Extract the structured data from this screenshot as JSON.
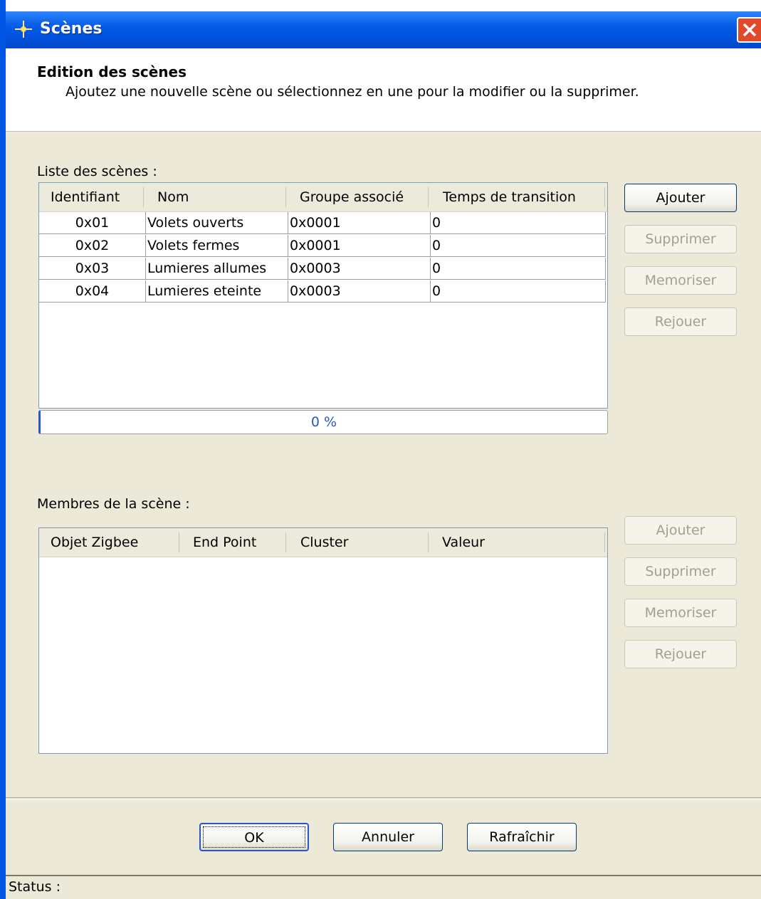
{
  "window": {
    "title": "Scènes"
  },
  "header": {
    "title": "Edition des scènes",
    "description": "Ajoutez une nouvelle scène ou sélectionnez en une pour la modifier ou la supprimer."
  },
  "scenes": {
    "label": "Liste des scènes :",
    "columns": [
      "Identifiant",
      "Nom",
      "Groupe associé",
      "Temps de transition"
    ],
    "rows": [
      [
        "0x01",
        "Volets ouverts",
        "0x0001",
        "0"
      ],
      [
        "0x02",
        "Volets fermes",
        "0x0001",
        "0"
      ],
      [
        "0x03",
        "Lumieres allumes",
        "0x0003",
        "0"
      ],
      [
        "0x04",
        "Lumieres eteinte",
        "0x0003",
        "0"
      ]
    ],
    "buttons": {
      "add": "Ajouter",
      "delete": "Supprimer",
      "memorize": "Memoriser",
      "replay": "Rejouer"
    },
    "progress": {
      "value": 0,
      "label": "0 %"
    }
  },
  "members": {
    "label": "Membres de la scène :",
    "columns": [
      "Objet Zigbee",
      "End Point",
      "Cluster",
      "Valeur"
    ],
    "buttons": {
      "add": "Ajouter",
      "delete": "Supprimer",
      "memorize": "Memoriser",
      "replay": "Rejouer"
    }
  },
  "footer": {
    "ok": "OK",
    "cancel": "Annuler",
    "refresh": "Rafraîchir"
  },
  "status": {
    "label": "Status :"
  },
  "colors": {
    "titlebar": "#0054E3",
    "accent": "#2C58C6",
    "dialog_bg": "#ECE9D8",
    "close": "#E04A2A"
  }
}
